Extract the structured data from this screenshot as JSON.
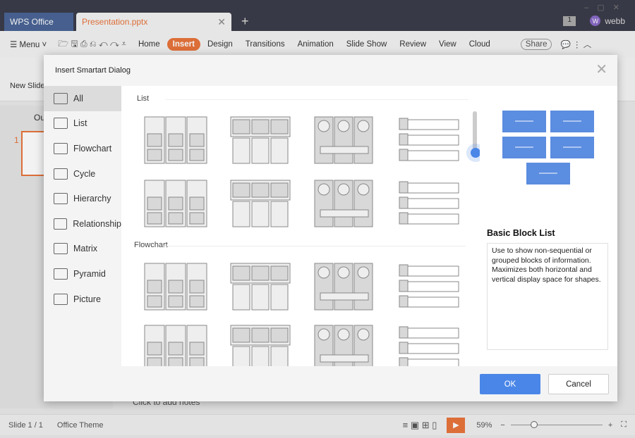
{
  "tabs": {
    "home": "WPS Office",
    "doc": "Presentation.pptx",
    "user": "webb",
    "user_initial": "W",
    "window_count": "1"
  },
  "toolbar": {
    "menu": "Menu",
    "tabs": [
      "Home",
      "Insert",
      "Design",
      "Transitions",
      "Animation",
      "Slide Show",
      "Review",
      "View",
      "Cloud"
    ],
    "active": "Insert",
    "share": "Share"
  },
  "ribbon": {
    "new_slide": "New Slide"
  },
  "sidebar": {
    "slide_number": "1",
    "outline_label": "Ou"
  },
  "notes": {
    "placeholder": "Click to add notes"
  },
  "status": {
    "slide": "Slide 1 / 1",
    "theme": "Office Theme",
    "zoom": "59%"
  },
  "dialog": {
    "title": "Insert Smartart Dialog",
    "nav": [
      "All",
      "List",
      "Flowchart",
      "Cycle",
      "Hierarchy",
      "Relationship",
      "Matrix",
      "Pyramid",
      "Picture"
    ],
    "selected_nav": "All",
    "sections": [
      "List",
      "Flowchart"
    ],
    "preview": {
      "name": "Basic Block List",
      "description": "Use to show non-sequential or grouped blocks of information. Maximizes both horizontal and vertical display space for shapes."
    },
    "ok": "OK",
    "cancel": "Cancel"
  },
  "colors": {
    "accent": "#e8743b",
    "primary": "#4a86e8"
  }
}
